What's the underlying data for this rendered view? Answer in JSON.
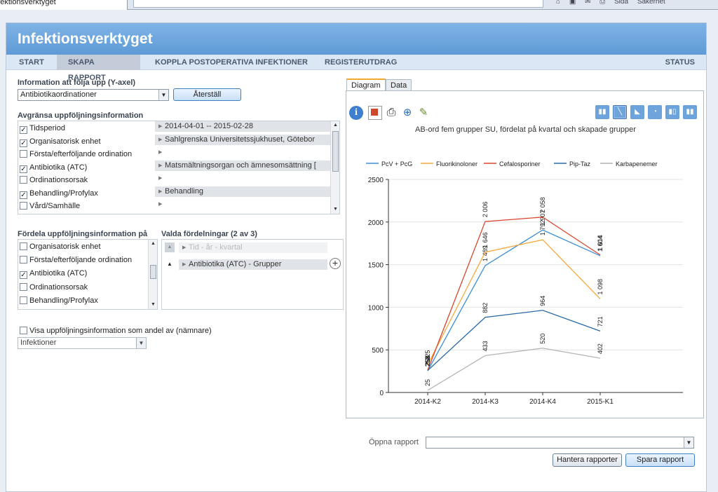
{
  "browser": {
    "tab_title": "Infektionsverktyget",
    "toolbar_items": [
      "Sida",
      "Säkerhet"
    ]
  },
  "app": {
    "title": "Infektionsverktyget"
  },
  "nav": {
    "items": [
      "START",
      "SKAPA RAPPORT",
      "KOPPLA POSTOPERATIVA INFEKTIONER",
      "REGISTERUTDRAG"
    ],
    "status": "STATUS",
    "active_index": 1
  },
  "left": {
    "yaxis_label": "Information att följa upp (Y-axel)",
    "yaxis_value": "Antibiotikaordinationer",
    "reset_button": "Återställ",
    "limit_label": "Avgränsa uppföljningsinformation",
    "limit_rows": [
      {
        "label": "Tidsperiod",
        "checked": true,
        "value": "2014-04-01 -- 2015-02-28"
      },
      {
        "label": "Organisatorisk enhet",
        "checked": true,
        "value": "Sahlgrenska Universitetssjukhuset, Götebor"
      },
      {
        "label": "Första/efterföljande ordination",
        "checked": false,
        "value": ""
      },
      {
        "label": "Antibiotika (ATC)",
        "checked": true,
        "value": "Matsmältningsorgan och ämnesomsättning ["
      },
      {
        "label": "Ordinationsorsak",
        "checked": false,
        "value": ""
      },
      {
        "label": "Behandling/Profylax",
        "checked": true,
        "value": "Behandling"
      },
      {
        "label": "Vård/Samhälle",
        "checked": false,
        "value": ""
      }
    ],
    "dist_label": "Fördela uppföljningsinformation på",
    "dist_rows": [
      {
        "label": "Organisatorisk enhet",
        "checked": false
      },
      {
        "label": "Första/efterföljande ordination",
        "checked": false
      },
      {
        "label": "Antibiotika (ATC)",
        "checked": true
      },
      {
        "label": "Ordinationsorsak",
        "checked": false
      },
      {
        "label": "Behandling/Profylax",
        "checked": false
      }
    ],
    "chosen_label": "Valda fördelningar (2 av 3)",
    "chosen": [
      "Tid - år - kvartal",
      "Antibiotika (ATC) - Grupper"
    ],
    "share_label": "Visa uppföljningsinformation som andel av (nämnare)",
    "share_value": "Infektioner"
  },
  "right": {
    "tabs": [
      "Diagram",
      "Data"
    ],
    "open_report_label": "Öppna rapport",
    "open_report_value": "",
    "manage_button": "Hantera rapporter",
    "save_button": "Spara rapport"
  },
  "colors": {
    "header": "#6ea7df",
    "accent": "#f0a830"
  },
  "chart_data": {
    "type": "line",
    "title": "AB-ord fem grupper SU, fördelat på kvartal och skapade grupper",
    "categories": [
      "2014-K2",
      "2014-K3",
      "2014-K4",
      "2015-K1"
    ],
    "ylim": [
      0,
      2500
    ],
    "yticks": [
      0,
      500,
      1000,
      1500,
      2000,
      2500
    ],
    "legend_position": "top",
    "grid": true,
    "series": [
      {
        "name": "PcV + PcG",
        "color": "#3d8ed6",
        "values": [
          253,
          1489,
          1907,
          1604
        ],
        "labels": [
          "253",
          "1 489",
          "1 907",
          "1 604"
        ]
      },
      {
        "name": "Fluorikinoloner",
        "color": "#f5a93c",
        "values": [
          325,
          1646,
          1792,
          1098
        ],
        "labels": [
          "325",
          "1 646",
          "1 792",
          "1 098"
        ]
      },
      {
        "name": "Cefalosporiner",
        "color": "#d9452c",
        "values": [
          263,
          2006,
          2058,
          1614
        ],
        "labels": [
          "263",
          "2 006",
          "2 058",
          "1 614"
        ]
      },
      {
        "name": "Pip-Taz",
        "color": "#2868a8",
        "values": [
          258,
          882,
          964,
          721
        ],
        "labels": [
          "258",
          "882",
          "964",
          "721"
        ]
      },
      {
        "name": "Karbapenemer",
        "color": "#b5b5b5",
        "values": [
          25,
          433,
          520,
          402
        ],
        "labels": [
          "25",
          "433",
          "520",
          "402"
        ]
      }
    ]
  }
}
